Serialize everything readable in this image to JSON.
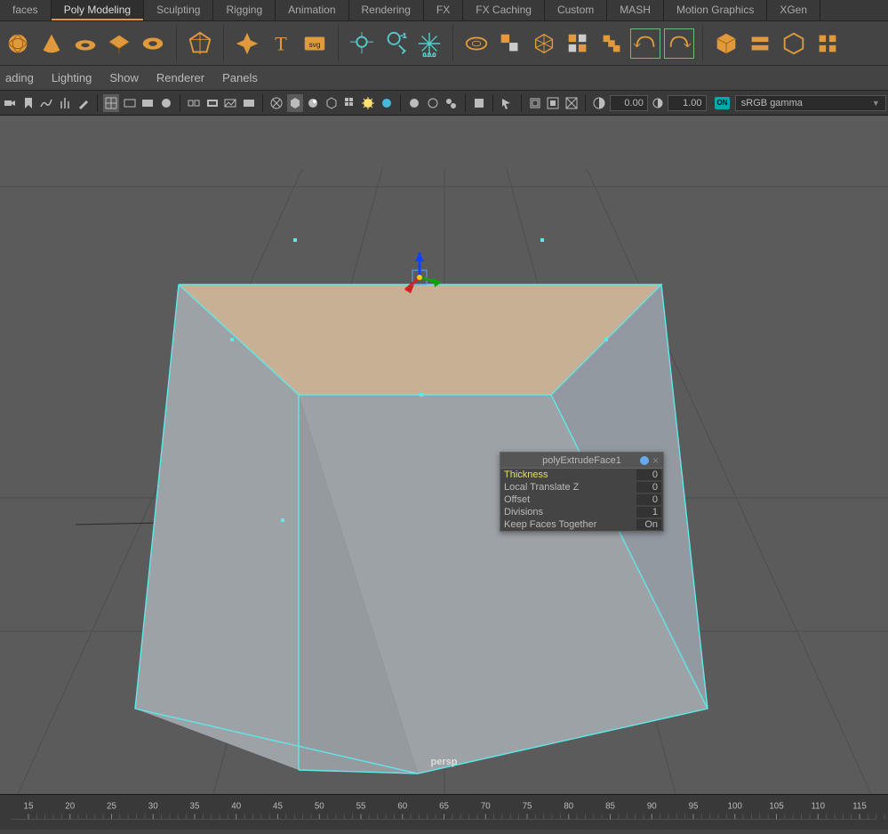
{
  "shelf": {
    "tabs": [
      "faces",
      "Poly Modeling",
      "Sculpting",
      "Rigging",
      "Animation",
      "Rendering",
      "FX",
      "FX Caching",
      "Custom",
      "MASH",
      "Motion Graphics",
      "XGen"
    ],
    "active_index": 1
  },
  "panel_menu": [
    "ading",
    "Lighting",
    "Show",
    "Renderer",
    "Panels"
  ],
  "iconbar_values": {
    "v1": "0.00",
    "v2": "1.00"
  },
  "on_chip": "ON",
  "view_transform": "sRGB gamma",
  "camera_name": "persp",
  "popup": {
    "title": "polyExtrudeFace1",
    "rows": [
      {
        "label": "Thickness",
        "value": "0",
        "highlight": true
      },
      {
        "label": "Local Translate Z",
        "value": "0"
      },
      {
        "label": "Offset",
        "value": "0"
      },
      {
        "label": "Divisions",
        "value": "1"
      },
      {
        "label": "Keep Faces Together",
        "value": "On"
      }
    ]
  },
  "timeline_ticks": [
    "15",
    "20",
    "25",
    "30",
    "35",
    "40",
    "45",
    "50",
    "55",
    "60",
    "65",
    "70",
    "75",
    "80",
    "85",
    "90",
    "95",
    "100",
    "105",
    "110",
    "115"
  ]
}
